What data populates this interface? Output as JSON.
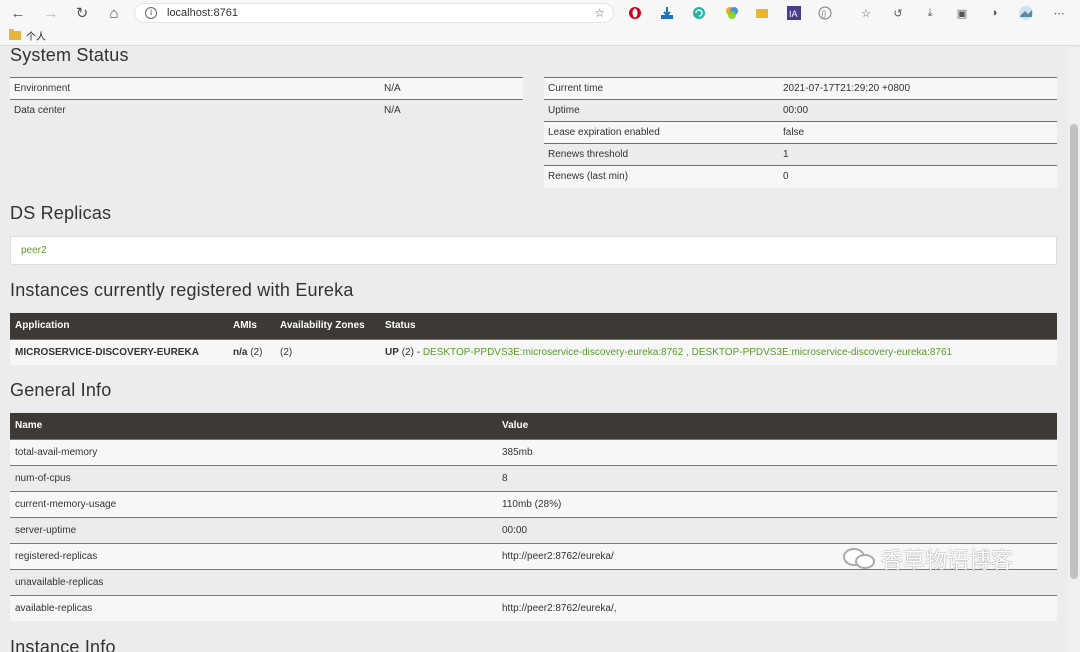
{
  "browser": {
    "url": "localhost:8761",
    "bookmark_folder": "个人"
  },
  "system_status": {
    "title": "System Status",
    "left_rows": [
      {
        "key": "Environment",
        "value": "N/A"
      },
      {
        "key": "Data center",
        "value": "N/A"
      }
    ],
    "right_rows": [
      {
        "key": "Current time",
        "value": "2021-07-17T21:29:20 +0800"
      },
      {
        "key": "Uptime",
        "value": "00:00"
      },
      {
        "key": "Lease expiration enabled",
        "value": "false"
      },
      {
        "key": "Renews threshold",
        "value": "1"
      },
      {
        "key": "Renews (last min)",
        "value": "0"
      }
    ]
  },
  "ds_replicas": {
    "title": "DS Replicas",
    "items": [
      "peer2"
    ]
  },
  "instances": {
    "title": "Instances currently registered with Eureka",
    "headers": [
      "Application",
      "AMIs",
      "Availability Zones",
      "Status"
    ],
    "rows": [
      {
        "application": "MICROSERVICE-DISCOVERY-EUREKA",
        "amis_label": "n/a",
        "amis_count": "(2)",
        "zones": "(2)",
        "status_prefix": "UP",
        "status_count": "(2) -",
        "instance_1": "DESKTOP-PPDVS3E:microservice-discovery-eureka:8762",
        "separator": ",",
        "instance_2": "DESKTOP-PPDVS3E:microservice-discovery-eureka:8761"
      }
    ]
  },
  "general_info": {
    "title": "General Info",
    "headers": [
      "Name",
      "Value"
    ],
    "rows": [
      {
        "name": "total-avail-memory",
        "value": "385mb"
      },
      {
        "name": "num-of-cpus",
        "value": "8"
      },
      {
        "name": "current-memory-usage",
        "value": "110mb (28%)"
      },
      {
        "name": "server-uptime",
        "value": "00:00"
      },
      {
        "name": "registered-replicas",
        "value": "http://peer2:8762/eureka/"
      },
      {
        "name": "unavailable-replicas",
        "value": ""
      },
      {
        "name": "available-replicas",
        "value": "http://peer2:8762/eureka/,"
      }
    ]
  },
  "instance_info": {
    "title": "Instance Info"
  },
  "watermark": "香草物语博客"
}
